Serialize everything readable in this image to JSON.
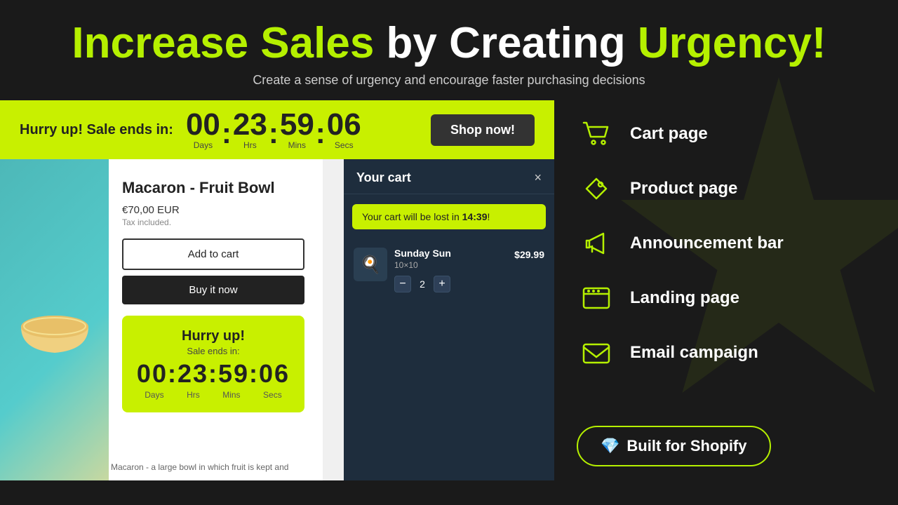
{
  "header": {
    "title_green1": "Increase Sales",
    "title_white": " by Creating",
    "title_green2": " Urgency!",
    "subtitle": "Create a sense of urgency and encourage faster purchasing decisions"
  },
  "announcement_bar": {
    "hurry_text": "Hurry up! Sale ends in:",
    "days": "00",
    "hrs": "23",
    "mins": "59",
    "secs": "06",
    "days_label": "Days",
    "hrs_label": "Hrs",
    "mins_label": "Mins",
    "secs_label": "Secs",
    "shop_button": "Shop now!"
  },
  "product": {
    "name": "Macaron - Fruit Bowl",
    "price": "€70,00 EUR",
    "tax": "Tax included.",
    "add_to_cart": "Add to cart",
    "buy_now": "Buy it now",
    "description": "Macaron - a large bowl in which fruit is kept and"
  },
  "hurry_box": {
    "title": "Hurry up!",
    "subtitle": "Sale ends in:",
    "countdown": "00:23:59:06",
    "days": "Days",
    "hrs": "Hrs",
    "mins": "Mins",
    "secs": "Secs"
  },
  "cart": {
    "title": "Your cart",
    "close": "×",
    "timer_text": "Your cart will be lost in ",
    "timer_value": "14:39",
    "timer_end": "!",
    "item": {
      "name": "Sunday Sun",
      "variant": "10×10",
      "quantity": 2,
      "price": "$29.99"
    }
  },
  "features": [
    {
      "id": "cart-page",
      "label": "Cart page",
      "icon": "cart"
    },
    {
      "id": "product-page",
      "label": "Product page",
      "icon": "tag"
    },
    {
      "id": "announcement-bar",
      "label": "Announcement bar",
      "icon": "megaphone"
    },
    {
      "id": "landing-page",
      "label": "Landing page",
      "icon": "browser"
    },
    {
      "id": "email-campaign",
      "label": "Email campaign",
      "icon": "email"
    }
  ],
  "shopify_btn": {
    "label": "Built for Shopify",
    "icon": "💎"
  }
}
